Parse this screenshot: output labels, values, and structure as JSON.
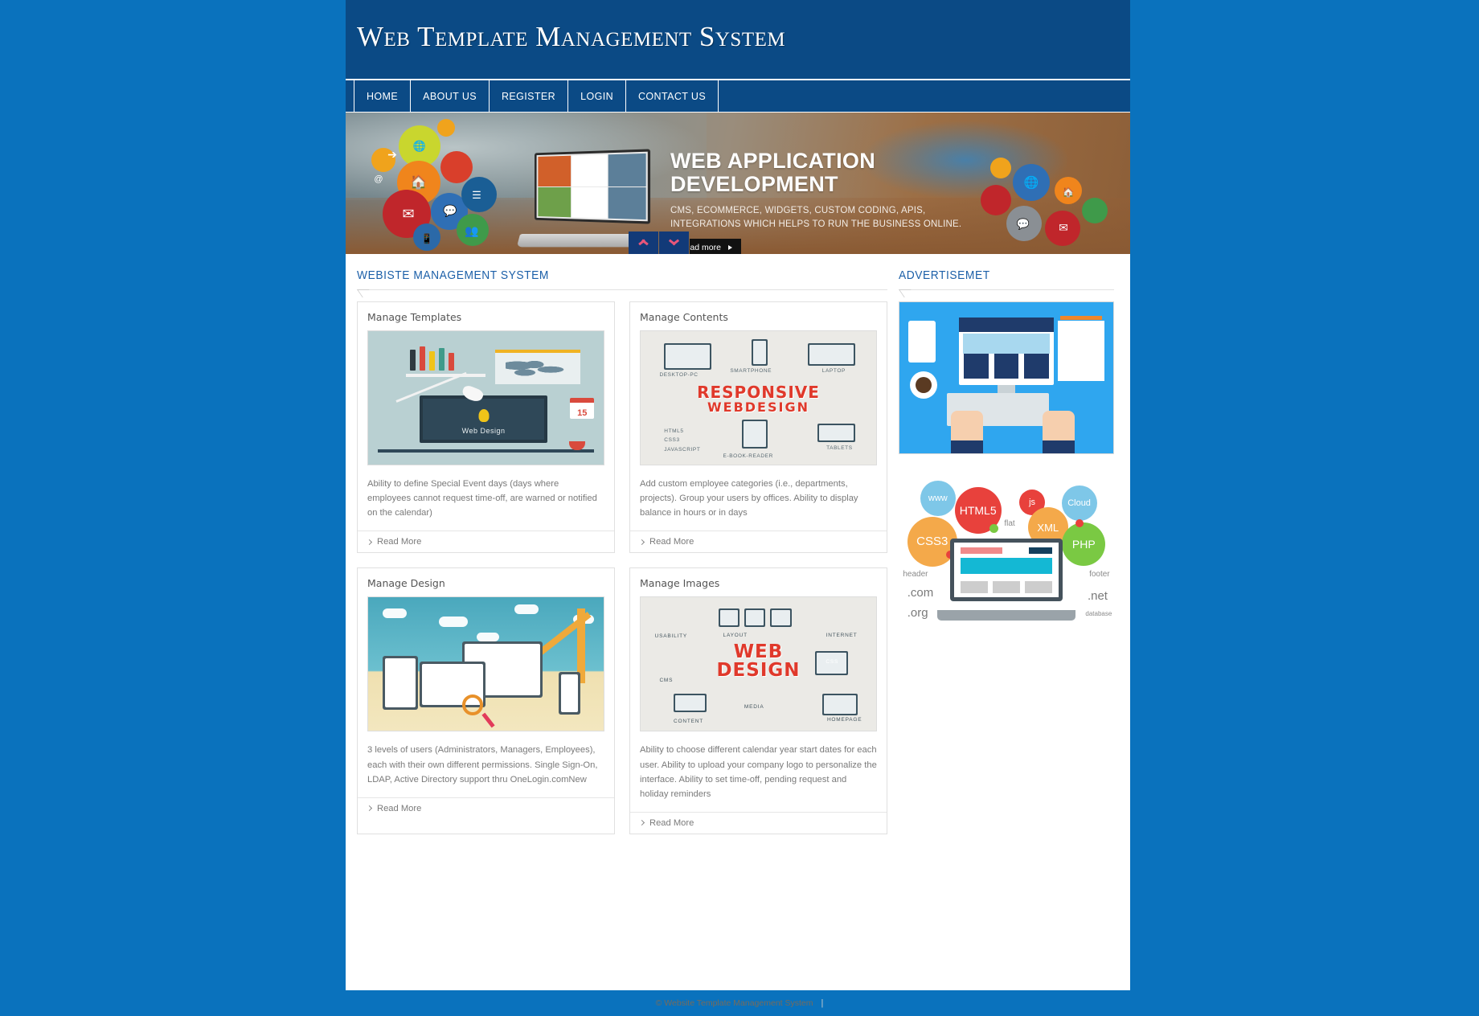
{
  "header": {
    "title": "Web Template Management System"
  },
  "nav": {
    "items": [
      {
        "label": "HOME"
      },
      {
        "label": "ABOUT US"
      },
      {
        "label": "REGISTER"
      },
      {
        "label": "LOGIN"
      },
      {
        "label": "CONTACT US"
      }
    ]
  },
  "banner": {
    "heading_line1": "WEB APPLICATION",
    "heading_line2": "DEVELOPMENT",
    "subtitle_line1": "CMS, ECOMMERCE, WIDGETS, CUSTOM CODING, APIS,",
    "subtitle_line2": "INTEGRATIONS WHICH HELPS TO RUN THE BUSINESS ONLINE.",
    "button_label": "Read more",
    "prev_icon": "chevron-up-icon",
    "next_icon": "chevron-down-icon"
  },
  "main": {
    "section_title": "WEBISTE MANAGEMENT SYSTEM",
    "read_more_label": "Read More",
    "cards": [
      {
        "title": "Manage Templates",
        "text": "Ability to define Special Event days (days where employees cannot request time-off, are warned or notified on the calendar)",
        "image_alt": "web-design-desk-illustration",
        "image_caption": "Web Design",
        "calendar_day": "15"
      },
      {
        "title": "Manage Contents",
        "text": "Add custom employee categories (i.e., departments, projects). Group your users by offices. Ability to display balance in hours or in days",
        "image_alt": "responsive-webdesign-illustration",
        "image_title_line1": "RESPONSIVE",
        "image_title_line2": "WEBDESIGN",
        "image_labels": [
          "DESKTOP-PC",
          "SMARTPHONE",
          "LAPTOP",
          "HTML5",
          "CSS3",
          "JAVASCRIPT",
          "E-BOOK-READER",
          "TABLETS"
        ]
      },
      {
        "title": "Manage Design",
        "text": "3 levels of users (Administrators, Managers, Employees), each with their own different permissions. Single Sign-On, LDAP, Active Directory support thru OneLogin.comNew",
        "image_alt": "responsive-devices-construction-illustration"
      },
      {
        "title": "Manage Images",
        "text": "Ability to choose different calendar year start dates for each user. Ability to upload your company logo to personalize the interface. Ability to set time-off, pending request and holiday reminders",
        "image_alt": "web-design-diagram-illustration",
        "image_title_line1": "WEB",
        "image_title_line2": "DESIGN",
        "image_labels": [
          "USABILITY",
          "LAYOUT",
          "INTERNET",
          "CSS",
          "CMS",
          "MEDIA",
          "CONTENT",
          "HOMEPAGE"
        ]
      }
    ]
  },
  "sidebar": {
    "section_title": "ADVERTISEMET",
    "ad1_alt": "flat-desk-workspace-illustration",
    "ad2_alt": "web-technology-bubbles-illustration",
    "ad2_bubbles": [
      {
        "label": "www",
        "color": "#7ec7e8"
      },
      {
        "label": "HTML5",
        "color": "#e8413c"
      },
      {
        "label": "CSS3",
        "color": "#f4a94a"
      },
      {
        "label": "js",
        "color": "#e8413c"
      },
      {
        "label": "Cloud",
        "color": "#7ec7e8"
      },
      {
        "label": "XML",
        "color": "#f4a94a"
      },
      {
        "label": "PHP",
        "color": "#7ac943"
      }
    ],
    "ad2_texts": [
      "flat",
      "header",
      "footer",
      ".com",
      ".org",
      ".net",
      "database"
    ]
  },
  "footer": {
    "copyright": "© Website Template Management System",
    "separator": "|"
  },
  "colors": {
    "page_background": "#0a72bd",
    "header_navy": "#0b4a85",
    "accent_blue": "#1b5fa8",
    "red": "#e0392b"
  }
}
